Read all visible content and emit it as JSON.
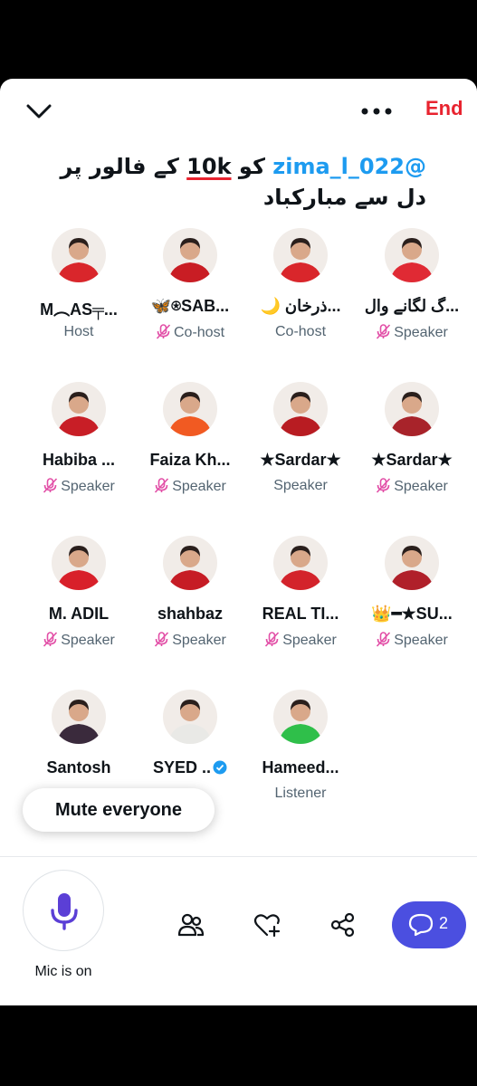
{
  "header": {
    "end_label": "End",
    "collapse_icon": "chevron-down-icon",
    "more_icon": "more-dots-icon"
  },
  "space": {
    "title_mention": "@zima_l_022",
    "title_text_1": "کو",
    "title_10k": "10k",
    "title_text_2": "کے فالور پر دل سے مبارکباد"
  },
  "participants": [
    {
      "name": "M︵AS╤...",
      "role": "Host",
      "muted": false,
      "avatar_color": "#d9262b"
    },
    {
      "name": "🦋⍟SAB...",
      "role": "Co-host",
      "muted": true,
      "avatar_color": "#c91d24"
    },
    {
      "name": "🌙 ذرخان...",
      "role": "Co-host",
      "muted": false,
      "avatar_color": "#d9262b"
    },
    {
      "name": "گ لگانے وال...",
      "role": "Speaker",
      "muted": true,
      "avatar_color": "#e02a34"
    },
    {
      "name": "Habiba ...",
      "role": "Speaker",
      "muted": true,
      "avatar_color": "#c81e26"
    },
    {
      "name": "Faiza Kh...",
      "role": "Speaker",
      "muted": true,
      "avatar_color": "#f15a22"
    },
    {
      "name": "★Sardar★",
      "role": "Speaker",
      "muted": false,
      "avatar_color": "#b81c22"
    },
    {
      "name": "★Sardar★",
      "role": "Speaker",
      "muted": true,
      "avatar_color": "#a8232a"
    },
    {
      "name": "M. ADIL",
      "role": "Speaker",
      "muted": true,
      "avatar_color": "#d8202a"
    },
    {
      "name": "shahbaz",
      "role": "Speaker",
      "muted": true,
      "avatar_color": "#c61c25"
    },
    {
      "name": "REAL TI...",
      "role": "Speaker",
      "muted": true,
      "avatar_color": "#d3232b"
    },
    {
      "name": "👑━★SU...",
      "role": "Speaker",
      "muted": true,
      "avatar_color": "#b0202a"
    },
    {
      "name": "Santosh",
      "role": "",
      "muted": false,
      "avatar_color": "#3a2a3c"
    },
    {
      "name": "SYED ..",
      "role": "",
      "muted": false,
      "verified": true,
      "avatar_color": "#e9e9e6"
    },
    {
      "name": "Hameed...",
      "role": "Listener",
      "muted": false,
      "avatar_color": "#2fbf4a"
    }
  ],
  "controls": {
    "mute_everyone_label": "Mute everyone",
    "mic_status_label": "Mic is on",
    "chat_count": "2",
    "icons": [
      "microphone-icon",
      "people-icon",
      "heart-plus-icon",
      "share-icon",
      "chat-bubble-icon"
    ]
  },
  "colors": {
    "accent_red": "#e8232f",
    "mention_blue": "#1d9bf0",
    "mic_purple": "#5b3fd6",
    "chat_button": "#4b4fe0",
    "muted_icon_pink": "#e24fa7"
  }
}
